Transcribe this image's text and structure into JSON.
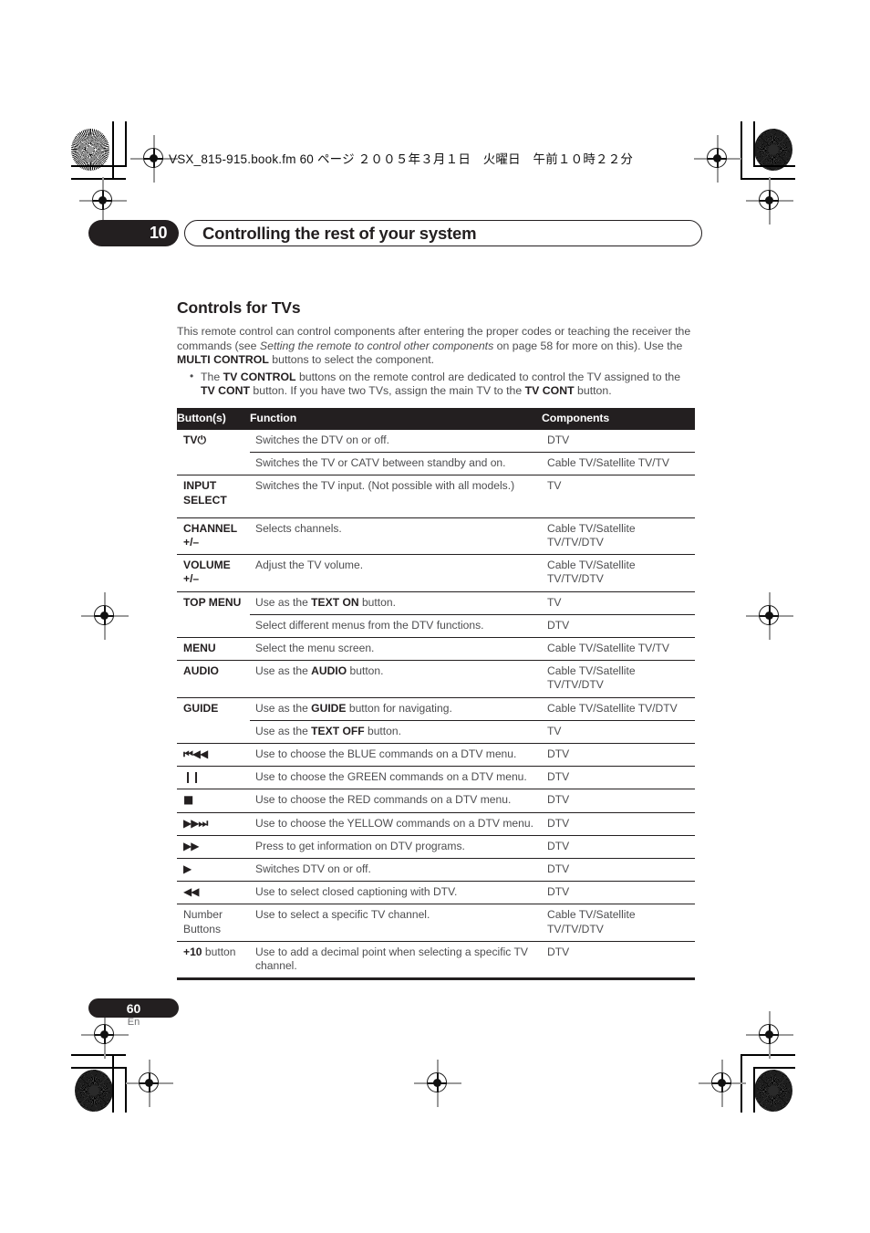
{
  "page": {
    "header_line": "VSX_815-915.book.fm  60 ページ  ２００５年３月１日　火曜日　午前１０時２２分",
    "chapter_number": "10",
    "chapter_title": "Controlling the rest of your system",
    "folio_number": "60",
    "folio_language": "En"
  },
  "section": {
    "title": "Controls for TVs",
    "intro_part1": "This remote control can control components after entering the proper codes or teaching the receiver the commands (see ",
    "intro_italic": "Setting the remote to control other components",
    "intro_part2": " on page 58 for more on this). Use the ",
    "intro_bold": "MULTI CONTROL",
    "intro_part3": " buttons to select the component.",
    "bullet_part1": "The ",
    "bullet_bold1": "TV CONTROL",
    "bullet_part2": " buttons on the remote control are dedicated to control the TV assigned to the ",
    "bullet_bold2": "TV CONT",
    "bullet_part3": " button. If you have two TVs, assign the main TV to the ",
    "bullet_bold3": "TV CONT",
    "bullet_part4": " button."
  },
  "table": {
    "headers": {
      "buttons": "Button(s)",
      "function": "Function",
      "components": "Components"
    },
    "rows": [
      {
        "group": true,
        "button": "TV",
        "button_icon": "⏻",
        "button_icon_name": "power-standby-icon",
        "function": "Switches the DTV on or off.",
        "components": "DTV"
      },
      {
        "group": false,
        "button": "",
        "function": "Switches the TV or CATV between standby and on.",
        "components": "Cable TV/Satellite TV/TV"
      },
      {
        "group": true,
        "button": "INPUT SELECT",
        "button_lines": [
          "INPUT",
          "SELECT"
        ],
        "function": "Switches the TV input. (Not possible with all models.)",
        "components": "TV",
        "pad_bottom": true
      },
      {
        "group": true,
        "button": "CHANNEL +/–",
        "button_lines": [
          "CHANNEL",
          "+/–"
        ],
        "function": "Selects channels.",
        "components": "Cable TV/Satellite TV/TV/DTV"
      },
      {
        "group": true,
        "button": "VOLUME +/–",
        "button_lines": [
          "VOLUME",
          "+/–"
        ],
        "function": "Adjust the TV volume.",
        "components": "Cable TV/Satellite TV/TV/DTV"
      },
      {
        "group": true,
        "button": "TOP MENU",
        "function_pre": "Use as the ",
        "function_bold": "TEXT ON",
        "function_post": " button.",
        "components": "TV"
      },
      {
        "group": false,
        "button": "",
        "function": "Select different menus from the DTV functions.",
        "components": "DTV"
      },
      {
        "group": true,
        "button": "MENU",
        "function": "Select the menu screen.",
        "components": "Cable TV/Satellite TV/TV"
      },
      {
        "group": true,
        "button": "AUDIO",
        "function_pre": "Use as the ",
        "function_bold": "AUDIO",
        "function_post": " button.",
        "components": "Cable TV/Satellite TV/TV/DTV"
      },
      {
        "group": true,
        "button": "GUIDE",
        "function_pre": "Use as the ",
        "function_bold": "GUIDE",
        "function_post": " button for navigating.",
        "components": "Cable TV/Satellite TV/DTV"
      },
      {
        "group": false,
        "button": "",
        "function_pre": "Use as the ",
        "function_bold": "TEXT OFF",
        "function_post": " button.",
        "components": "TV"
      },
      {
        "group": true,
        "button_icon": "⏮◀◀",
        "button_icon_name": "previous-track-icon",
        "function": "Use to choose the BLUE commands on a DTV menu.",
        "components": "DTV"
      },
      {
        "group": true,
        "button_icon": "❙❙",
        "button_icon_name": "pause-icon",
        "function": "Use to choose the GREEN commands on a DTV menu.",
        "components": "DTV"
      },
      {
        "group": true,
        "button_icon": "■",
        "button_icon_name": "stop-icon",
        "function": "Use to choose the RED commands on a DTV menu.",
        "components": "DTV"
      },
      {
        "group": true,
        "button_icon": "▶▶⏭",
        "button_icon_name": "next-track-icon",
        "function": "Use to choose the YELLOW commands on a DTV menu.",
        "components": "DTV"
      },
      {
        "group": true,
        "button_icon": "▶▶",
        "button_icon_name": "fast-forward-icon",
        "function": "Press to get information on DTV programs.",
        "components": "DTV"
      },
      {
        "group": true,
        "button_icon": "▶",
        "button_icon_name": "play-icon",
        "function": "Switches DTV on or off.",
        "components": "DTV"
      },
      {
        "group": true,
        "button_icon": "◀◀",
        "button_icon_name": "rewind-icon",
        "function": "Use to select closed captioning with DTV.",
        "components": "DTV"
      },
      {
        "group": true,
        "button": "Number Buttons",
        "button_lines": [
          "Number",
          "Buttons"
        ],
        "button_light": true,
        "function": "Use to select a specific TV channel.",
        "components": "Cable TV/Satellite TV/TV/DTV"
      },
      {
        "group": true,
        "button_bold": "+10",
        "button_suffix": " button",
        "function": "Use to add a decimal point when selecting a specific TV channel.",
        "components": "DTV"
      }
    ]
  }
}
